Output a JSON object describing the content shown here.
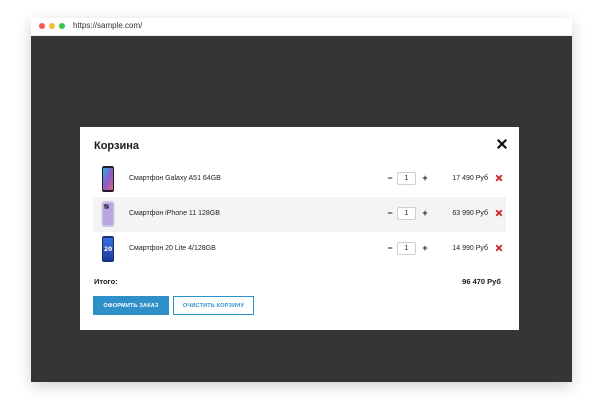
{
  "browser": {
    "url": "https://sample.com/"
  },
  "cart": {
    "title": "Корзина",
    "items": [
      {
        "name": "Смартфон Galaxy A51 64GB",
        "quantity": "1",
        "price": "17 490 Руб",
        "minus": "−",
        "plus": "+",
        "thumb_icon": "phone-galaxy-icon"
      },
      {
        "name": "Смартфон iPhone 11 128GB",
        "quantity": "1",
        "price": "63 990 Руб",
        "minus": "−",
        "plus": "+",
        "thumb_icon": "phone-iphone-icon"
      },
      {
        "name": "Смартфон 20 Lite 4/128GB",
        "quantity": "1",
        "price": "14 990 Руб",
        "minus": "−",
        "plus": "+",
        "thumb_icon": "phone-honor-icon"
      }
    ],
    "total_label": "Итого:",
    "total_value": "96 470 Руб",
    "order_button": "Оформить заказ",
    "clear_button": "Очистить корзину"
  },
  "colors": {
    "accent": "#2f8fc9",
    "remove": "#d0202a",
    "overlay": "#353535"
  }
}
